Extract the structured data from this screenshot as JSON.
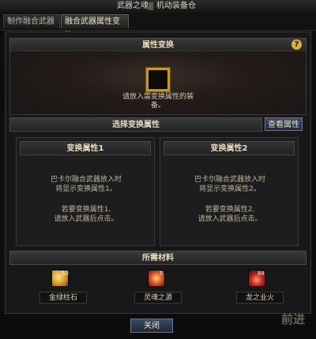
{
  "titlebar": {
    "left": "武器之魂",
    "right": "机动装备仓"
  },
  "tabs": [
    {
      "label": "制作融合武器",
      "active": false
    },
    {
      "label": "融合武器属性变换",
      "active": true
    }
  ],
  "attribute_change": {
    "header": "属性变换",
    "help": "?",
    "slot_hint": "请放入需变换属性的装备。"
  },
  "select_attribute": {
    "header": "选择变换属性",
    "view_button": "查看属性"
  },
  "panels": [
    {
      "title": "变换属性1",
      "line1": "巴卡尔融合武器放入时",
      "line2": "将显示变换属性1。",
      "line3": "若要变换属性1,",
      "line4": "请放入武器后点击。"
    },
    {
      "title": "变换属性2",
      "line1": "巴卡尔融合武器放入时",
      "line2": "将显示变换属性2。",
      "line3": "若要变换属性2,",
      "line4": "请放入武器后点击。"
    }
  ],
  "materials": {
    "header": "所需材料",
    "items": [
      {
        "name": "金绿柱石",
        "count": "50",
        "icon": "beryl-gem-icon",
        "color": "#d49a22"
      },
      {
        "name": "灵魂之源",
        "count": "5",
        "icon": "soul-source-icon",
        "color": "#c8401c"
      },
      {
        "name": "龙之业火",
        "count": "88",
        "icon": "dragon-fire-icon",
        "color": "#b8221e"
      }
    ]
  },
  "footer": {
    "close_button": "关闭",
    "corner_text": "前进"
  }
}
